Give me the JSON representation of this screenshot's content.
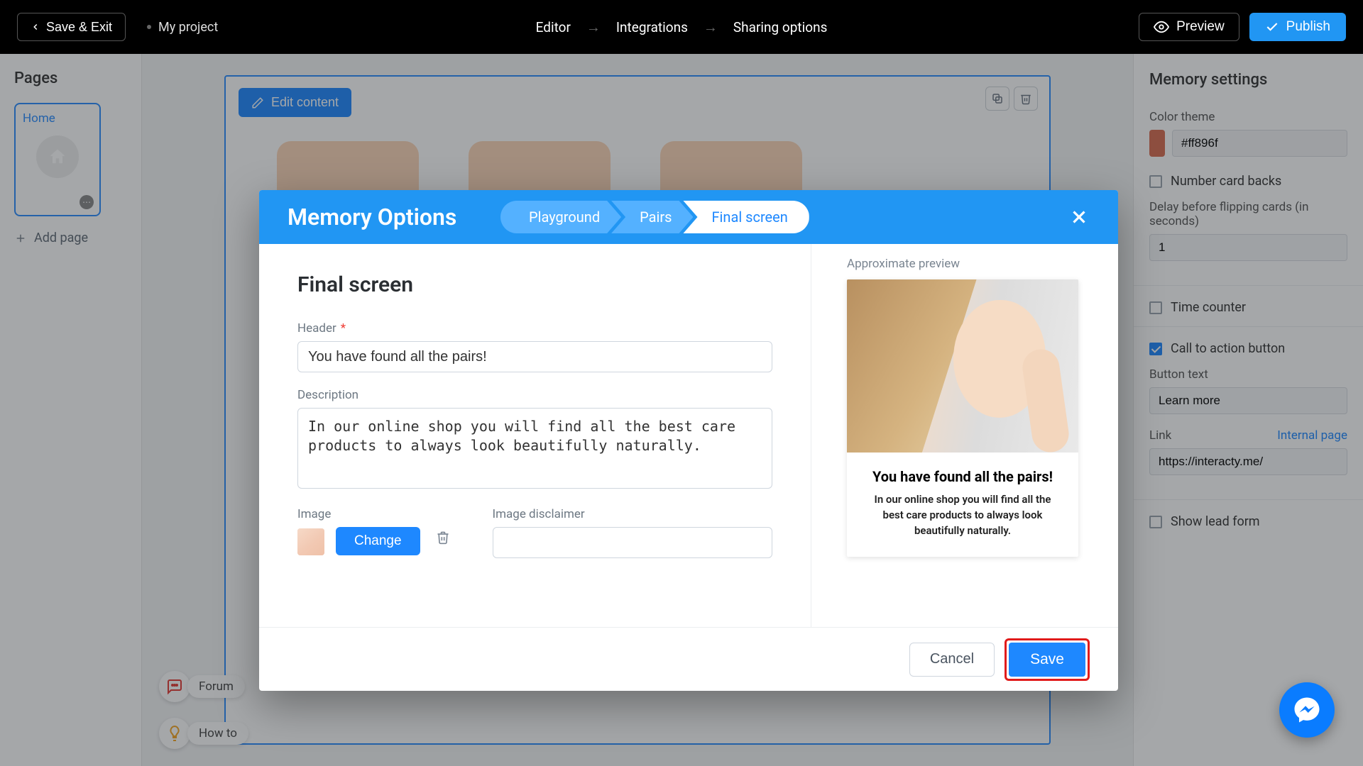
{
  "topbar": {
    "save_exit": "Save & Exit",
    "project": "My project",
    "steps": {
      "editor": "Editor",
      "integrations": "Integrations",
      "sharing": "Sharing options"
    },
    "preview": "Preview",
    "publish": "Publish"
  },
  "left": {
    "title": "Pages",
    "page_home": "Home",
    "add_page": "Add page"
  },
  "help": {
    "forum": "Forum",
    "howto": "How to"
  },
  "right": {
    "title": "Memory settings",
    "color_theme_label": "Color theme",
    "color_hex": "#ff896f",
    "number_card_backs": "Number card backs",
    "delay_label": "Delay before flipping cards (in seconds)",
    "delay_value": "1",
    "time_counter": "Time counter",
    "cta": "Call to action button",
    "button_text_label": "Button text",
    "button_text": "Learn more",
    "link_label": "Link",
    "internal_page": "Internal page",
    "link_value": "https://interacty.me/",
    "show_lead_form": "Show lead form"
  },
  "canvas": {
    "edit_content": "Edit content"
  },
  "modal": {
    "title": "Memory Options",
    "crumbs": {
      "playground": "Playground",
      "pairs": "Pairs",
      "final": "Final screen"
    },
    "section": "Final screen",
    "header_label": "Header",
    "header_value": "You have found all the pairs!",
    "desc_label": "Description",
    "desc_value": "In our online shop you will find all the best care products to always look beautifully naturally.",
    "image_label": "Image",
    "change": "Change",
    "disclaimer_label": "Image disclaimer",
    "disclaimer_value": "",
    "approx": "Approximate preview",
    "preview": {
      "h": "You have found all the pairs!",
      "p": "In our online shop you will find all the best care products to always look beautifully naturally."
    },
    "cancel": "Cancel",
    "save": "Save"
  }
}
